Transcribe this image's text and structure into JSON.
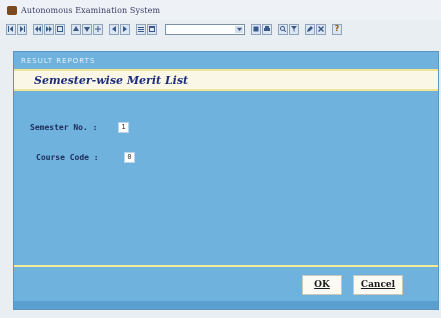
{
  "window": {
    "title": "Autonomous Examination System"
  },
  "toolbar": {
    "combo_value": "",
    "help_label": "?"
  },
  "report": {
    "section_label": "RESULT REPORTS",
    "title": "Semester-wise Merit List"
  },
  "form": {
    "semester_label": "Semester No. :",
    "semester_value": "1",
    "course_label": "Course Code :",
    "course_value": "0"
  },
  "actions": {
    "ok_label": "OK",
    "cancel_label": "Cancel"
  },
  "colors": {
    "panel": "#6fb2de",
    "title_band": "#fbf7e6",
    "band_border": "#efe59a",
    "title_text": "#1c2e7a"
  }
}
